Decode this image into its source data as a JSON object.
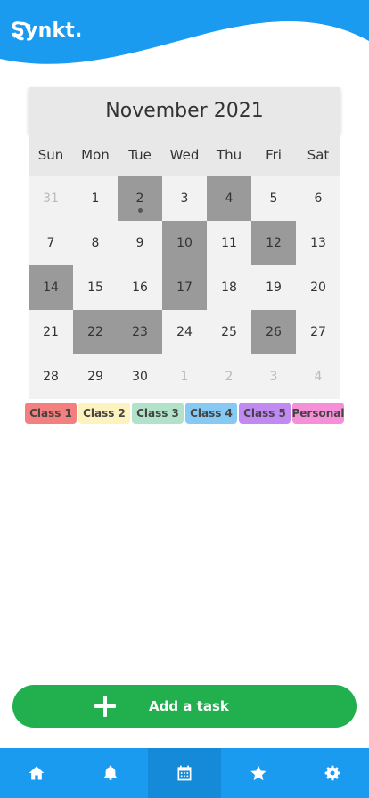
{
  "header": {
    "brand": "Synkt.",
    "logo_icon": "sync-icon",
    "color": "#1a9bf0"
  },
  "calendar": {
    "title": "November 2021",
    "weekdays": [
      "Sun",
      "Mon",
      "Tue",
      "Wed",
      "Thu",
      "Fri",
      "Sat"
    ],
    "days": [
      {
        "label": "31",
        "muted": true,
        "marked": false
      },
      {
        "label": "1",
        "muted": false,
        "marked": false
      },
      {
        "label": "2",
        "muted": false,
        "marked": true,
        "dot": true
      },
      {
        "label": "3",
        "muted": false,
        "marked": false
      },
      {
        "label": "4",
        "muted": false,
        "marked": true
      },
      {
        "label": "5",
        "muted": false,
        "marked": false
      },
      {
        "label": "6",
        "muted": false,
        "marked": false
      },
      {
        "label": "7",
        "muted": false,
        "marked": false
      },
      {
        "label": "8",
        "muted": false,
        "marked": false
      },
      {
        "label": "9",
        "muted": false,
        "marked": false
      },
      {
        "label": "10",
        "muted": false,
        "marked": true
      },
      {
        "label": "11",
        "muted": false,
        "marked": false
      },
      {
        "label": "12",
        "muted": false,
        "marked": true
      },
      {
        "label": "13",
        "muted": false,
        "marked": false
      },
      {
        "label": "14",
        "muted": false,
        "marked": true
      },
      {
        "label": "15",
        "muted": false,
        "marked": false
      },
      {
        "label": "16",
        "muted": false,
        "marked": false
      },
      {
        "label": "17",
        "muted": false,
        "marked": true
      },
      {
        "label": "18",
        "muted": false,
        "marked": false
      },
      {
        "label": "19",
        "muted": false,
        "marked": false
      },
      {
        "label": "20",
        "muted": false,
        "marked": false
      },
      {
        "label": "21",
        "muted": false,
        "marked": false
      },
      {
        "label": "22",
        "muted": false,
        "marked": true
      },
      {
        "label": "23",
        "muted": false,
        "marked": true
      },
      {
        "label": "24",
        "muted": false,
        "marked": false
      },
      {
        "label": "25",
        "muted": false,
        "marked": false
      },
      {
        "label": "26",
        "muted": false,
        "marked": true
      },
      {
        "label": "27",
        "muted": false,
        "marked": false
      },
      {
        "label": "28",
        "muted": false,
        "marked": false
      },
      {
        "label": "29",
        "muted": false,
        "marked": false
      },
      {
        "label": "30",
        "muted": false,
        "marked": false
      },
      {
        "label": "1",
        "muted": true,
        "marked": false
      },
      {
        "label": "2",
        "muted": true,
        "marked": false
      },
      {
        "label": "3",
        "muted": true,
        "marked": false
      },
      {
        "label": "4",
        "muted": true,
        "marked": false
      }
    ],
    "marked_color": "#9a9a9a"
  },
  "classes": [
    {
      "label": "Class 1",
      "color": "#f47f7f"
    },
    {
      "label": "Class 2",
      "color": "#fdf3bf"
    },
    {
      "label": "Class 3",
      "color": "#b3e2cb"
    },
    {
      "label": "Class 4",
      "color": "#86c9f2"
    },
    {
      "label": "Class 5",
      "color": "#c08af0"
    },
    {
      "label": "Personal",
      "color": "#f58fd8"
    }
  ],
  "add_task": {
    "label": "Add a task",
    "color": "#22b04f"
  },
  "bottom_nav": {
    "items": [
      {
        "icon": "home-icon",
        "active": false
      },
      {
        "icon": "bell-icon",
        "active": false
      },
      {
        "icon": "calendar-icon",
        "active": true
      },
      {
        "icon": "star-icon",
        "active": false
      },
      {
        "icon": "gear-icon",
        "active": false
      }
    ]
  }
}
